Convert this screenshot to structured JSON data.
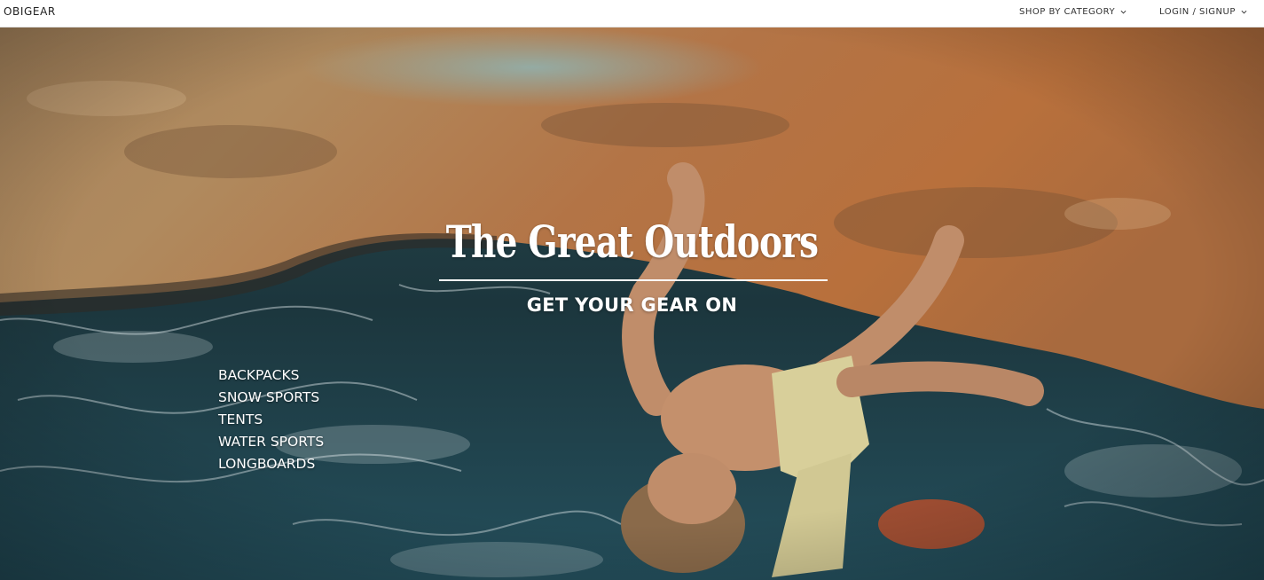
{
  "header": {
    "brand": "OBIGEAR",
    "nav": [
      {
        "label": "SHOP BY CATEGORY",
        "icon": "chevron-down-icon"
      },
      {
        "label": "LOGIN / SIGNUP",
        "icon": "chevron-down-icon"
      }
    ]
  },
  "hero": {
    "title": "The Great Outdoors",
    "subtitle": "GET YOUR GEAR ON",
    "categories": [
      "BACKPACKS",
      "SNOW SPORTS",
      "TENTS",
      "WATER SPORTS",
      "LONGBOARDS"
    ],
    "image_subject": "climber hanging upside down on overhanging rock above ocean"
  },
  "colors": {
    "header_bg": "#ffffff",
    "rock": "#b5713f",
    "sea": "#1f3d45",
    "text": "#ffffff"
  }
}
